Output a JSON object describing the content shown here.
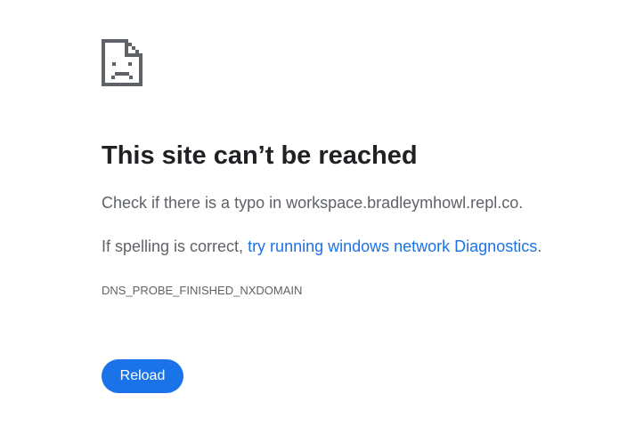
{
  "error_page": {
    "icon": "sad-document-icon",
    "title": "This site can’t be reached",
    "check_message": "Check if there is a typo in workspace.bradleymhowl.repl.co.",
    "spelling_prefix": "If spelling is correct, ",
    "diagnostics_link": "try running windows network Diagnostics",
    "spelling_suffix": ".",
    "error_code": "DNS_PROBE_FINISHED_NXDOMAIN",
    "reload_label": "Reload"
  },
  "colors": {
    "accent": "#1a73e8",
    "title_text": "#202124",
    "body_text": "#5f6368",
    "icon": "#5f6368"
  }
}
